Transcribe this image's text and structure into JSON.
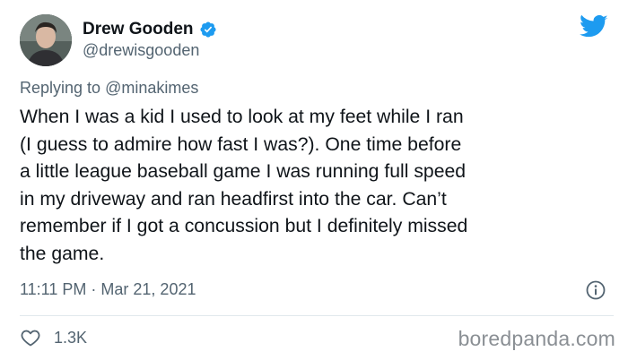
{
  "author": {
    "name": "Drew Gooden",
    "handle": "@drewisgooden",
    "verified": true
  },
  "reply": {
    "prefix": "Replying to",
    "mention": "@minakimes"
  },
  "tweet": {
    "lines": [
      "When I was a kid I used to look at my feet while I ran",
      "(I guess to admire how fast I was?). One time before",
      "a little league baseball game I was running full speed",
      "in my driveway and ran headfirst into the car. Can’t",
      "remember if I got a concussion but I definitely missed",
      "the game."
    ]
  },
  "meta": {
    "time": "11:11 PM",
    "separator": "·",
    "date": "Mar 21, 2021"
  },
  "engagement": {
    "likes": "1.3K"
  },
  "watermark": "boredpanda.com",
  "colors": {
    "text": "#0f1419",
    "muted": "#536471",
    "twitter_blue": "#1d9bf0",
    "divider": "#e1e8ed"
  },
  "icons": {
    "verified": "verified-badge-icon",
    "brand": "twitter-bird-icon",
    "info": "info-icon",
    "like": "heart-icon"
  }
}
